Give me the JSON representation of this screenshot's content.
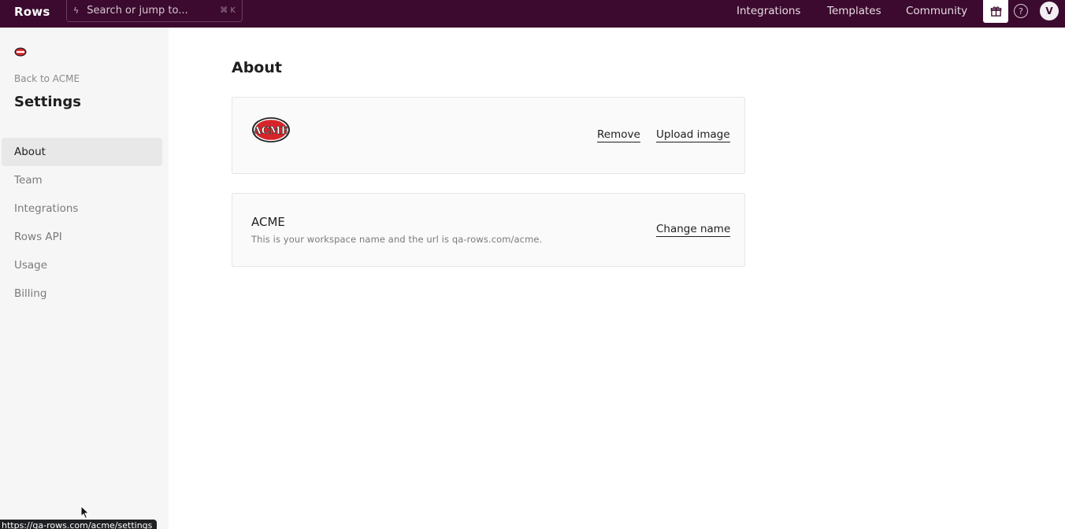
{
  "topbar": {
    "brand": "Rows",
    "search": {
      "placeholder": "Search or jump to...",
      "shortcut": "⌘ K"
    },
    "links": [
      "Integrations",
      "Templates",
      "Community"
    ],
    "help_label": "?",
    "avatar_initial": "V"
  },
  "sidebar": {
    "back_label": "Back to ACME",
    "title": "Settings",
    "items": [
      {
        "label": "About",
        "active": true
      },
      {
        "label": "Team"
      },
      {
        "label": "Integrations"
      },
      {
        "label": "Rows API"
      },
      {
        "label": "Usage"
      },
      {
        "label": "Billing"
      }
    ]
  },
  "main": {
    "title": "About",
    "logo_card": {
      "logo_text": "ACME",
      "remove_label": "Remove",
      "upload_label": "Upload image"
    },
    "name_card": {
      "name": "ACME",
      "description": "This is your workspace name and the url is qa-rows.com/acme.",
      "change_label": "Change name"
    }
  },
  "status": {
    "url": "https://qa-rows.com/acme/settings"
  },
  "colors": {
    "topbar_bg": "#3b0a2e",
    "acme_red": "#d6242a"
  }
}
